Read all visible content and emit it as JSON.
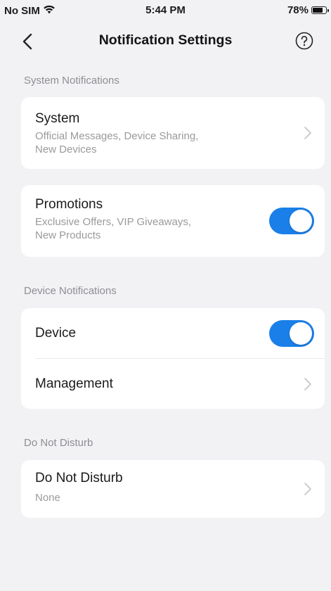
{
  "status_bar": {
    "carrier": "No SIM",
    "time": "5:44 PM",
    "battery": "78%",
    "battery_level": 0.78
  },
  "nav": {
    "title": "Notification Settings"
  },
  "sections": [
    {
      "header": "System Notifications",
      "system_row": {
        "title": "System",
        "subtitle_line1": "Official Messages, Device Sharing,",
        "subtitle_line2": "New Devices"
      },
      "promotions_row": {
        "title": "Promotions",
        "subtitle_line1": "Exclusive Offers, VIP Giveaways,",
        "subtitle_line2": "New Products",
        "enabled": true
      }
    },
    {
      "header": "Device Notifications",
      "device_row": {
        "title": "Device",
        "enabled": true
      },
      "management_row": {
        "title": "Management"
      }
    },
    {
      "header": "Do Not Disturb",
      "dnd_row": {
        "title": "Do Not Disturb",
        "value": "None"
      }
    }
  ],
  "colors": {
    "accent": "#1a7fe8",
    "background": "#f2f2f5",
    "card": "#ffffff",
    "secondary_text": "#8e8e93"
  },
  "icons": {
    "wifi": "wifi-icon",
    "battery": "battery-icon",
    "back": "chevron-left-icon",
    "help": "help-circle-icon",
    "chevron": "chevron-right-icon"
  }
}
